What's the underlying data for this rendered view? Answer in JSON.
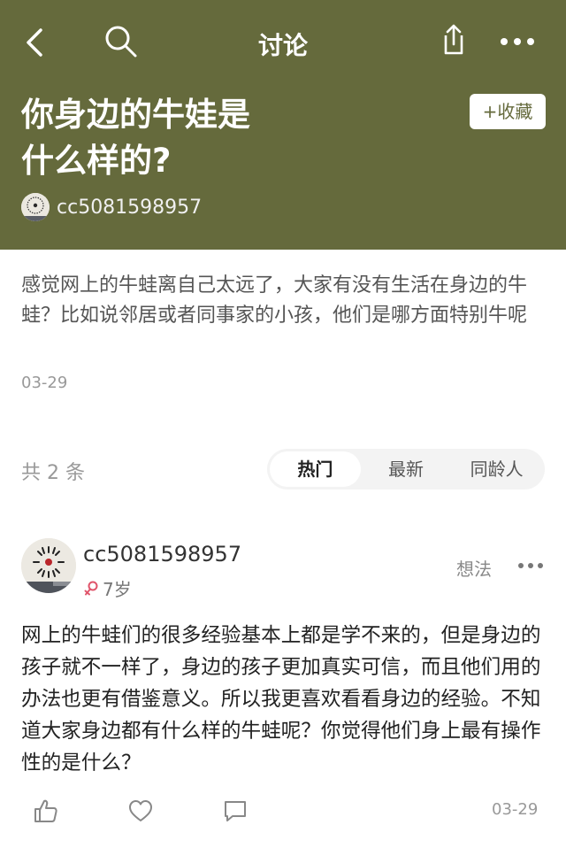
{
  "nav": {
    "title": "讨论",
    "back_icon": "back-arrow-icon",
    "search_icon": "search-icon",
    "share_icon": "share-icon",
    "more_icon": "more-icon"
  },
  "colors": {
    "header_bg": "#656a3c",
    "female_symbol": "#e0556b"
  },
  "post": {
    "title_line1": "你身边的牛娃是",
    "title_line2": "什么样的?",
    "collect_label": "+收藏",
    "author_name": "cc5081598957",
    "body": "感觉网上的牛蛙离自己太远了，大家有没有生活在身边的牛蛙？比如说邻居或者同事家的小孩，他们是哪方面特别牛呢",
    "date": "03-29"
  },
  "comments_bar": {
    "count": "共 2 条",
    "tabs": [
      "热门",
      "最新",
      "同龄人"
    ],
    "active_tab": 0
  },
  "comment": {
    "author_name": "cc5081598957",
    "child_age": "7岁",
    "type_label": "想法",
    "text": "网上的牛蛙们的很多经验基本上都是学不来的，但是身边的孩子就不一样了，身边的孩子更加真实可信，而且他们用的办法也更有借鉴意义。所以我更喜欢看看身边的经验。不知道大家身边都有什么样的牛蛙呢？你觉得他们身上最有操作性的是什么？",
    "date": "03-29"
  }
}
